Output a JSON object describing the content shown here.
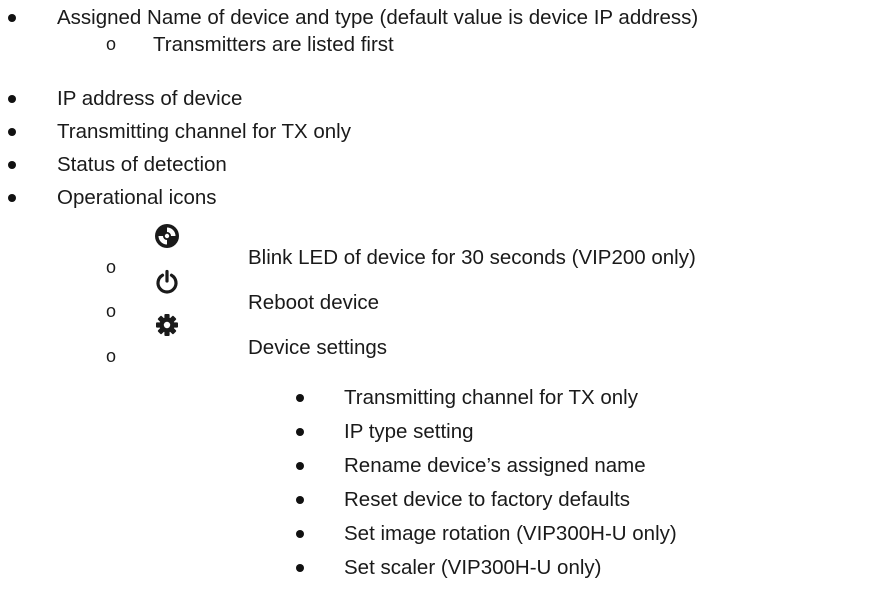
{
  "list": {
    "item_assigned_name": "Assigned Name of device and type (default value is device IP address)",
    "sub_transmitters_first": "Transmitters are listed first",
    "item_ip_address": "IP address of device",
    "item_transmitting_channel": "Transmitting channel for TX only",
    "item_status": "Status of detection",
    "item_operational_icons": "Operational icons",
    "op_blink": "Blink LED of device for 30 seconds (VIP200 only)",
    "op_reboot": "Reboot device",
    "op_settings": "Device settings",
    "settings_items": [
      "Transmitting channel for TX only",
      "IP type setting",
      "Rename device’s assigned name",
      "Reset device to factory defaults",
      "Set image rotation (VIP300H-U only)",
      "Set scaler (VIP300H-U only)"
    ],
    "sub_bullet_glyph": "o"
  },
  "icons": {
    "blink": "disc-icon",
    "reboot": "power-icon",
    "settings": "gear-icon"
  }
}
